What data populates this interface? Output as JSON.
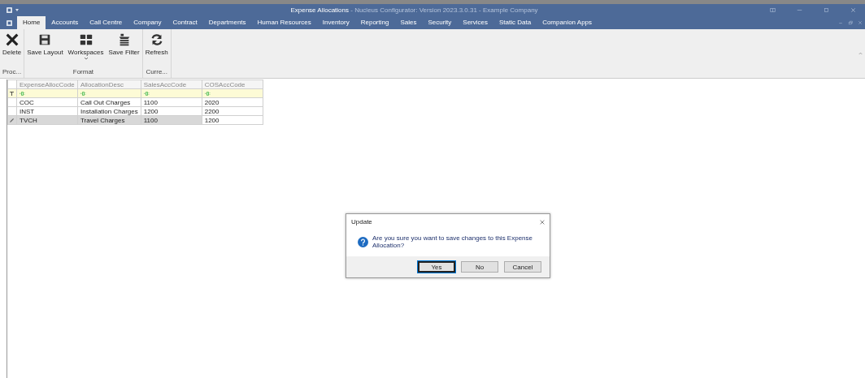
{
  "window": {
    "title": "Expense Allocations",
    "subtitle": " - Nucleus Configurator: Version 2023.3.0.31 - Example Company"
  },
  "tabs": [
    {
      "label": "Home",
      "selected": true
    },
    {
      "label": "Accounts",
      "selected": false
    },
    {
      "label": "Call Centre",
      "selected": false
    },
    {
      "label": "Company",
      "selected": false
    },
    {
      "label": "Contract",
      "selected": false
    },
    {
      "label": "Departments",
      "selected": false
    },
    {
      "label": "Human Resources",
      "selected": false
    },
    {
      "label": "Inventory",
      "selected": false
    },
    {
      "label": "Reporting",
      "selected": false
    },
    {
      "label": "Sales",
      "selected": false
    },
    {
      "label": "Security",
      "selected": false
    },
    {
      "label": "Services",
      "selected": false
    },
    {
      "label": "Static Data",
      "selected": false
    },
    {
      "label": "Companion Apps",
      "selected": false
    }
  ],
  "ribbon": [
    {
      "label": "Proc...",
      "buttons": [
        {
          "label": "Delete",
          "kind": "delete"
        }
      ]
    },
    {
      "label": "Format",
      "buttons": [
        {
          "label": "Save Layout",
          "kind": "save"
        },
        {
          "label": "Workspaces",
          "kind": "grid"
        },
        {
          "label": "Save Filter",
          "kind": "filter"
        }
      ]
    },
    {
      "label": "Curre...",
      "buttons": [
        {
          "label": "Refresh",
          "kind": "refresh"
        }
      ]
    }
  ],
  "table": {
    "columns": [
      "ExpenseAllocCode",
      "AllocationDesc",
      "SalesAccCode",
      "COSAccCode"
    ],
    "rows": [
      {
        "cells": [
          "COC",
          "Call Out Charges",
          "1100",
          "2020"
        ],
        "selected": false
      },
      {
        "cells": [
          "INST",
          "Installation Charges",
          "1200",
          "2200"
        ],
        "selected": false
      },
      {
        "cells": [
          "TVCH",
          "Travel Charges",
          "1100",
          "1200"
        ],
        "selected": true
      }
    ]
  },
  "dialog": {
    "title": "Update",
    "message": "Are you sure you want to save changes to this Expense Allocation?",
    "buttons": [
      {
        "label": "Yes",
        "selected": true
      },
      {
        "label": "No",
        "selected": false
      },
      {
        "label": "Cancel",
        "selected": false
      }
    ]
  }
}
